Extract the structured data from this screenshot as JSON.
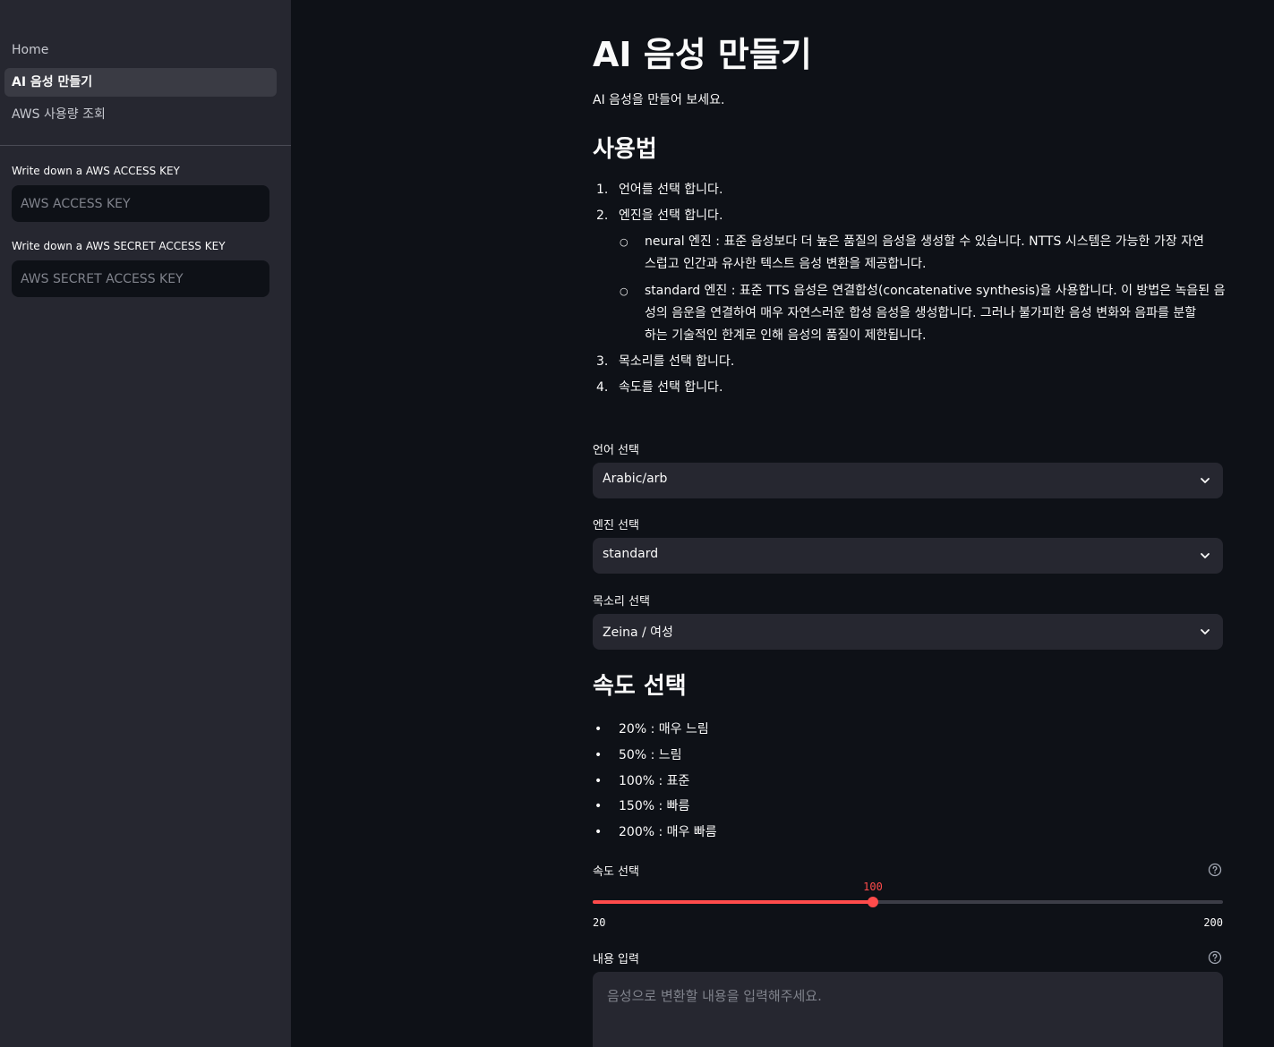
{
  "sidebar": {
    "nav": [
      {
        "label": "Home",
        "active": false
      },
      {
        "label": "AI 음성 만들기",
        "active": true
      },
      {
        "label": "AWS 사용량 조회",
        "active": false
      }
    ],
    "access_key": {
      "label": "Write down a AWS ACCESS KEY",
      "placeholder": "AWS ACCESS KEY"
    },
    "secret_key": {
      "label": "Write down a AWS SECRET ACCESS KEY",
      "placeholder": "AWS SECRET ACCESS KEY"
    }
  },
  "main": {
    "title": "AI 음성 만들기",
    "intro": "AI 음성을 만들어 보세요.",
    "usage": {
      "heading": "사용법",
      "steps": [
        "언어를 선택 합니다.",
        "엔진을 선택 합니다.",
        "목소리를 선택 합니다.",
        "속도를 선택 합니다."
      ],
      "step_numbers": [
        "1.",
        "2.",
        "3.",
        "4."
      ],
      "engines": [
        {
          "line1": "neural 엔진 : 표준 음성보다 더 높은 품질의 음성을 생성할 수 있습니다. NTTS 시스템은 가능한 가장 자연",
          "line2": "스럽고 인간과 유사한 텍스트 음성 변환을 제공합니다."
        },
        {
          "line1": "standard 엔진 : 표준 TTS 음성은 연결합성(concatenative synthesis)을 사용합니다. 이 방법은 녹음된 음",
          "line2": "성의 음운을 연결하여 매우 자연스러운 합성 음성을 생성합니다. 그러나 불가피한 음성 변화와 음파를 분할",
          "line3": "하는 기술적인 한계로 인해 음성의 품질이 제한됩니다."
        }
      ]
    },
    "language": {
      "label": "언어 선택",
      "value": "Arabic/arb"
    },
    "engine": {
      "label": "엔진 선택",
      "value": "standard"
    },
    "voice": {
      "label": "목소리 선택",
      "value": "Zeina / 여성"
    },
    "speed": {
      "heading": "속도 선택",
      "options": [
        "20% : 매우 느림",
        "50% : 느림",
        "100% : 표준",
        "150% : 빠름",
        "200% : 매우 빠름"
      ],
      "label": "속도 선택",
      "value": 100,
      "value_label": "100",
      "min": 20,
      "max": 200,
      "min_label": "20",
      "max_label": "200"
    },
    "content": {
      "label": "내용 입력",
      "placeholder": "음성으로 변환할 내용을 입력해주세요."
    }
  },
  "colors": {
    "accent": "#ff4b4b",
    "sidebar_bg": "#262730",
    "main_bg": "#0e1117"
  }
}
